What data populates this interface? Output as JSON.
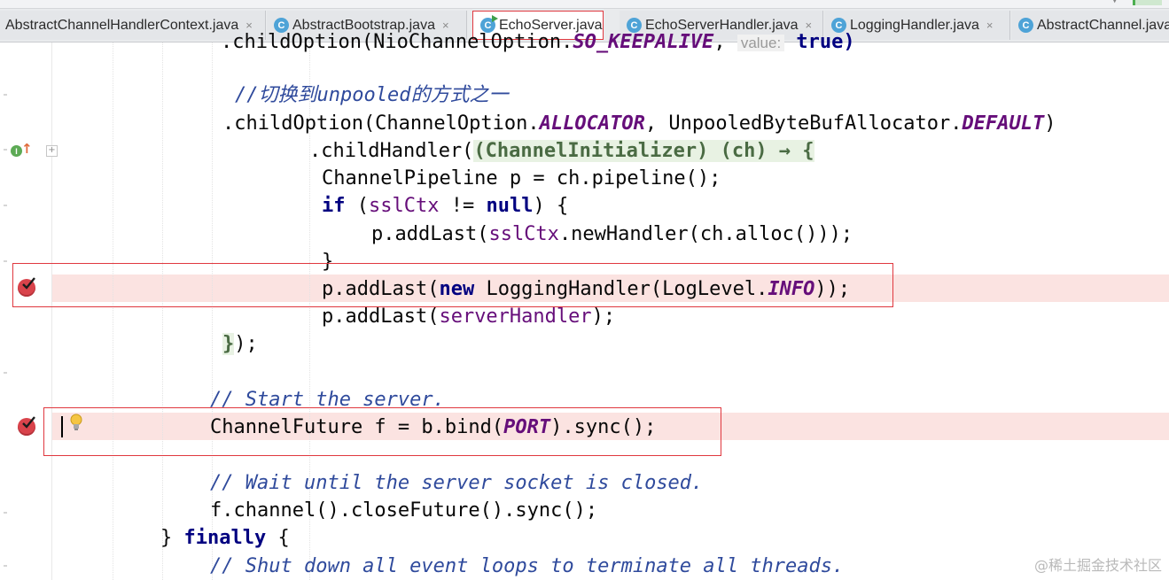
{
  "tabs": [
    {
      "label": "AbstractChannelHandlerContext.java",
      "close": "×",
      "active": false
    },
    {
      "label": "AbstractBootstrap.java",
      "close": "×",
      "active": false
    },
    {
      "label": "EchoServer.java",
      "close": "",
      "active": true
    },
    {
      "label": "EchoServerHandler.java",
      "close": "×",
      "active": false
    },
    {
      "label": "LoggingHandler.java",
      "close": "×",
      "active": false
    },
    {
      "label": "AbstractChannel.java",
      "close": "",
      "active": false
    }
  ],
  "icons": {
    "class_icon_letter": "C",
    "impl_letter": "I",
    "fold_symbol": "+",
    "impl_arrow": "↑"
  },
  "code": {
    "l0_a": ".childOption(NioChannelOption.",
    "l0_b": "SO_KEEPALIVE",
    "l0_c": ", ",
    "l0_hint": "value:",
    "l0_d": " true)",
    "l1": "//切换到unpooled的方式之一",
    "l2_a": ".childOption(ChannelOption.",
    "l2_b": "ALLOCATOR",
    "l2_c": ", UnpooledByteBufAllocator.",
    "l2_d": "DEFAULT",
    "l2_e": ")",
    "l3_a": ".childHandler(",
    "l3_b": "(ChannelInitializer) (ch) → {",
    "l4": "ChannelPipeline p = ch.pipeline();",
    "l5_a": "if",
    "l5_b": " (",
    "l5_c": "sslCtx",
    "l5_d": " != ",
    "l5_e": "null",
    "l5_f": ") {",
    "l6_a": "p.addLast(",
    "l6_b": "sslCtx",
    "l6_c": ".newHandler(ch.alloc()));",
    "l7": "}",
    "l8_a": "p.addLast(",
    "l8_b": "new",
    "l8_c": " LoggingHandler(LogLevel.",
    "l8_d": "INFO",
    "l8_e": "));",
    "l9_a": "p.addLast(",
    "l9_b": "serverHandler",
    "l9_c": ");",
    "l10_a": "}",
    "l10_b": ");",
    "l11": "// Start the server.",
    "l12_a": "ChannelFuture f = b.bind(",
    "l12_b": "PORT",
    "l12_c": ").sync();",
    "l13": "// Wait until the server socket is closed.",
    "l14": "f.channel().closeFuture().sync();",
    "l15_a": "} ",
    "l15_b": "finally",
    "l15_c": " {",
    "l16": "// Shut down all event loops to terminate all threads."
  },
  "watermark": "@稀土掘金技术社区",
  "colors": {
    "keyword": "#000080",
    "static_field": "#660e7a",
    "comment": "#2f4a9c",
    "breakpoint": "#d9434b",
    "highlight_box": "#e0383f"
  }
}
